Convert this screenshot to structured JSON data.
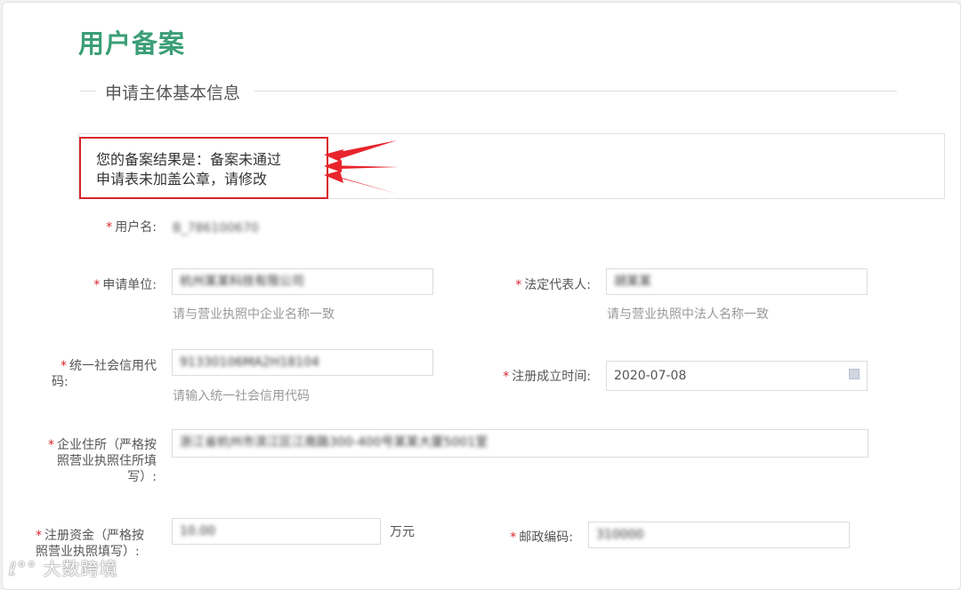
{
  "page": {
    "title": "用户备案",
    "section_title": "申请主体基本信息"
  },
  "result": {
    "line1": "您的备案结果是：备案未通过",
    "line2": "申请表未加盖公章，请修改"
  },
  "form": {
    "required_mark": "*",
    "username": {
      "label": "用户名:",
      "value": "B_786100670"
    },
    "company": {
      "label": "申请单位:",
      "value": "杭州某某科技有限公司",
      "hint": "请与营业执照中企业名称一致"
    },
    "legal_rep": {
      "label": "法定代表人:",
      "value": "胡某某",
      "hint": "请与营业执照中法人名称一致"
    },
    "credit_code": {
      "label_line1": "统一社会信用代",
      "label_line2": "码:",
      "value": "91330106MA2H18104",
      "hint": "请输入统一社会信用代码"
    },
    "reg_date": {
      "label": "注册成立时间:",
      "value": "2020-07-08"
    },
    "address": {
      "label_line1": "企业住所（严格按",
      "label_line2": "照营业执照住所填",
      "label_line3": "写）:",
      "value": "浙江省杭州市滨江区江南路300-400号某某大厦5001室"
    },
    "capital": {
      "label_line1": "注册资金（严格按",
      "label_line2": "照营业执照填写）:",
      "value": "10.00",
      "unit": "万元"
    },
    "postcode": {
      "label": "邮政编码:",
      "value": "310000"
    }
  },
  "watermark": {
    "text": "大数跨境"
  },
  "colors": {
    "title_green": "#3a9e76",
    "required_red": "#d9232b",
    "highlight_red": "#d9232b"
  }
}
